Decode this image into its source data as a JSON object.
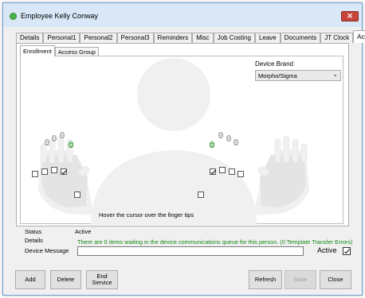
{
  "window": {
    "title": "Employee Kelly Conway",
    "close_glyph": "✕"
  },
  "tabs": [
    {
      "label": "Details"
    },
    {
      "label": "Personal1"
    },
    {
      "label": "Personal2"
    },
    {
      "label": "Personal3"
    },
    {
      "label": "Reminders"
    },
    {
      "label": "Misc"
    },
    {
      "label": "Job Costing"
    },
    {
      "label": "Leave"
    },
    {
      "label": "Documents"
    },
    {
      "label": "JT Clock"
    },
    {
      "label": "Access",
      "active": true
    }
  ],
  "subtabs": [
    {
      "label": "Enrollment",
      "active": true
    },
    {
      "label": "Access Group"
    }
  ],
  "enrollment": {
    "device_brand_label": "Device Brand",
    "device_brand_value": "Morpho/Sigma",
    "hint": "Hover the cursor over the finger tips",
    "left_hand": [
      {
        "finger": "pinky",
        "checked": false,
        "enrolled": false
      },
      {
        "finger": "ring",
        "checked": false,
        "enrolled": false
      },
      {
        "finger": "middle",
        "checked": false,
        "enrolled": false
      },
      {
        "finger": "index",
        "checked": true,
        "enrolled": true
      },
      {
        "finger": "thumb",
        "checked": false,
        "enrolled": false
      }
    ],
    "right_hand": [
      {
        "finger": "thumb",
        "checked": false,
        "enrolled": false
      },
      {
        "finger": "index",
        "checked": true,
        "enrolled": true
      },
      {
        "finger": "middle",
        "checked": false,
        "enrolled": false
      },
      {
        "finger": "ring",
        "checked": false,
        "enrolled": false
      },
      {
        "finger": "pinky",
        "checked": false,
        "enrolled": false
      }
    ]
  },
  "status": {
    "status_label": "Status",
    "status_value": "Active",
    "details_label": "Details",
    "details_value": "There are 0 items waiting in the device communications queue for this person. (0 Template Transfer Errors)",
    "message_label": "Device Message",
    "message_value": "",
    "active_label": "Active",
    "active_checked": true
  },
  "buttons": {
    "add": "Add",
    "delete": "Delete",
    "end_service": "End\nService",
    "refresh": "Refresh",
    "save": "Save",
    "close": "Close"
  },
  "colors": {
    "enrolled_green": "#3b9b3b",
    "details_green": "#128a12",
    "close_red": "#c7463b"
  }
}
